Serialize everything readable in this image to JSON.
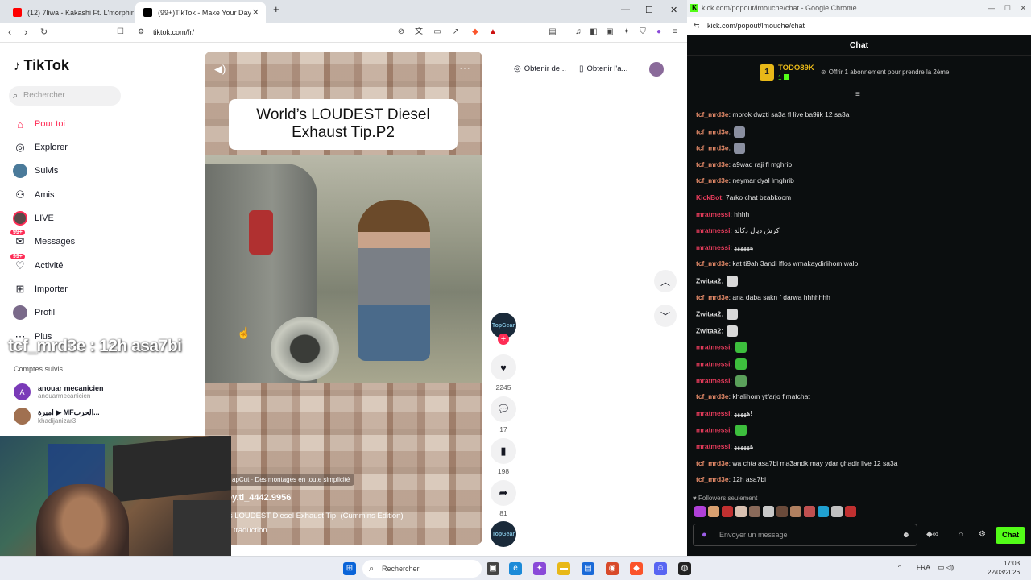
{
  "left_browser": {
    "tabs": [
      {
        "title": "(12) 7liwa - Kakashi Ft. L'morphine -",
        "favicon_color": "#ff0000"
      },
      {
        "title": "(99+)TikTok - Make Your Day",
        "favicon_color": "#000000"
      }
    ],
    "new_tab": "+",
    "url": "tiktok.com/fr/",
    "window_controls": {
      "minimize": "—",
      "maximize": "☐",
      "close": "✕"
    }
  },
  "tiktok": {
    "logo": "TikTok",
    "search_placeholder": "Rechercher",
    "nav": [
      {
        "label": "Pour toi",
        "icon": "home-icon",
        "active": true
      },
      {
        "label": "Explorer",
        "icon": "compass-icon"
      },
      {
        "label": "Suivis",
        "icon": "following-avatar-icon"
      },
      {
        "label": "Amis",
        "icon": "friends-icon"
      },
      {
        "label": "LIVE",
        "icon": "live-icon"
      },
      {
        "label": "Messages",
        "icon": "messages-icon",
        "badge": "99+"
      },
      {
        "label": "Activité",
        "icon": "activity-icon",
        "badge": "99+"
      },
      {
        "label": "Importer",
        "icon": "upload-icon"
      },
      {
        "label": "Profil",
        "icon": "profile-icon"
      },
      {
        "label": "Plus",
        "icon": "more-icon"
      }
    ],
    "overlay_caption": "tcf_mrd3e : 12h asa7bi",
    "followed_heading": "Comptes suivis",
    "followed": [
      {
        "name": "anouar mecanicien",
        "handle": "anouarmecanicien",
        "initial": "A"
      },
      {
        "name": "اميرة ▶ MFالحرب...",
        "handle": "khadijanizar3",
        "initial": ""
      }
    ],
    "top_actions": [
      "Obtenir de...",
      "Obtenir l'a..."
    ],
    "video": {
      "title_line1": "World’s LOUDEST Diesel",
      "title_line2": "Exhaust Tip.P2",
      "capcut": "apCut · Des montages en toute simplicité",
      "username": "ey.tl_4442.9956",
      "description": "'s LOUDEST Diesel Exhaust Tip! (Cummins Edition)",
      "translation": "n traduction"
    },
    "channel_badge": "TopGear",
    "actions": {
      "likes": "2245",
      "comments": "17",
      "saves": "198",
      "shares": "81"
    }
  },
  "chat_browser": {
    "title": "kick.com/popout/lmouche/chat - Google Chrome",
    "url": "kick.com/popout/lmouche/chat",
    "header": "Chat",
    "pinned": {
      "rank": "1",
      "name": "TODO89K",
      "sub": "1",
      "text": "Offrir 1 abonnement pour prendre la 2ème"
    },
    "messages": [
      {
        "user": "tcf_mrd3e",
        "color": "#e88c6a",
        "text": "mbrok dwzti sa3a fl live ba9iik 12 sa3a",
        "emotes": []
      },
      {
        "user": "tcf_mrd3e",
        "color": "#e88c6a",
        "text": "",
        "emotes": [
          "#8a8fa0"
        ]
      },
      {
        "user": "tcf_mrd3e",
        "color": "#e88c6a",
        "text": "",
        "emotes": [
          "#8a8fa0"
        ]
      },
      {
        "user": "tcf_mrd3e",
        "color": "#e88c6a",
        "text": "a9wad raji fl mghrib",
        "emotes": []
      },
      {
        "user": "tcf_mrd3e",
        "color": "#e88c6a",
        "text": "neymar dyal lmghrib",
        "emotes": []
      },
      {
        "user": "KickBot",
        "color": "#e83c5c",
        "text": "7arko chat bzabkoom",
        "emotes": []
      },
      {
        "user": "mratmessi",
        "color": "#e83c5c",
        "text": "hhhh",
        "emotes": []
      },
      {
        "user": "mratmessi",
        "color": "#e83c5c",
        "text": "كرش ديال دكالة",
        "emotes": []
      },
      {
        "user": "mratmessi",
        "color": "#e83c5c",
        "text": "ﻫﻬﻬﻬﻬﻬ",
        "emotes": []
      },
      {
        "user": "tcf_mrd3e",
        "color": "#e88c6a",
        "text": "kat ti9ah 3andi lflos wmakaydirlihom walo",
        "emotes": []
      },
      {
        "user": "Zwitaa2",
        "color": "#dddddd",
        "text": "",
        "emotes": [
          "#d8d8d8"
        ]
      },
      {
        "user": "tcf_mrd3e",
        "color": "#e88c6a",
        "text": "ana daba sakn f darwa hhhhhhh",
        "emotes": []
      },
      {
        "user": "Zwitaa2",
        "color": "#dddddd",
        "text": "",
        "emotes": [
          "#d8d8d8"
        ]
      },
      {
        "user": "Zwitaa2",
        "color": "#dddddd",
        "text": "",
        "emotes": [
          "#d8d8d8"
        ]
      },
      {
        "user": "mratmessi",
        "color": "#e83c5c",
        "text": "",
        "emotes": [
          "#3dbf3d"
        ]
      },
      {
        "user": "mratmessi",
        "color": "#e83c5c",
        "text": "",
        "emotes": [
          "#3dbf3d"
        ]
      },
      {
        "user": "mratmessi",
        "color": "#e83c5c",
        "text": "",
        "emotes": [
          "#5aa05a"
        ]
      },
      {
        "user": "tcf_mrd3e",
        "color": "#e88c6a",
        "text": "khalihom ytfarjo flmatchat",
        "emotes": []
      },
      {
        "user": "mratmessi",
        "color": "#e83c5c",
        "text": "ﻫﻬﻬﻬﻬ!",
        "emotes": []
      },
      {
        "user": "mratmessi",
        "color": "#e83c5c",
        "text": "",
        "emotes": [
          "#3dbf3d"
        ]
      },
      {
        "user": "mratmessi",
        "color": "#e83c5c",
        "text": "ﻫﻬﻬﻬﻬﻬ",
        "emotes": []
      },
      {
        "user": "tcf_mrd3e",
        "color": "#e88c6a",
        "text": "wa chta asa7bi ma3andk may ydar ghadir live 12 sa3a",
        "emotes": []
      },
      {
        "user": "tcf_mrd3e",
        "color": "#e88c6a",
        "text": "12h asa7bi",
        "emotes": []
      }
    ],
    "followers_only": "Followers seulement",
    "emote_bar_colors": [
      "#b040d8",
      "#d8a070",
      "#c03030",
      "#d8c0b0",
      "#8a6a5a",
      "#c8c8c8",
      "#6a4a3a",
      "#b08060",
      "#c05050",
      "#20a0d0",
      "#c0c0c0",
      "#c03030"
    ],
    "input_placeholder": "Envoyer un message",
    "send_label": "Chat",
    "accent": "#53fc18"
  },
  "taskbar": {
    "search": "Rechercher",
    "lang": "FRA",
    "time": "17:03",
    "date": "22/03/2026"
  }
}
